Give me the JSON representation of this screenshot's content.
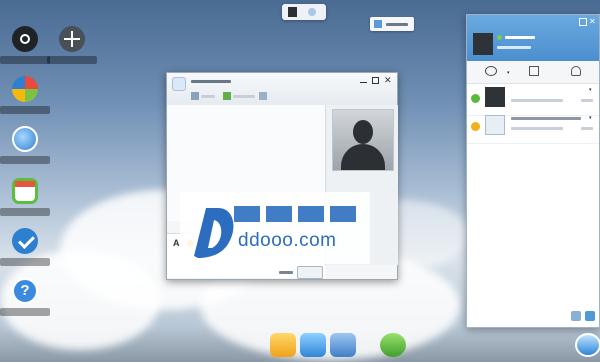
{
  "watermark": {
    "site": "ddooo.com"
  },
  "colors": {
    "panel_header": "#4c8fcf",
    "accent": "#2f6fbf",
    "watermark": "#2c6dbf"
  },
  "icons": [
    "settings-icon",
    "add-icon",
    "office-icon",
    "browser-icon",
    "calendar-icon",
    "oa-icon",
    "help-icon",
    "chat-icon",
    "list-icon",
    "contact-icon"
  ]
}
